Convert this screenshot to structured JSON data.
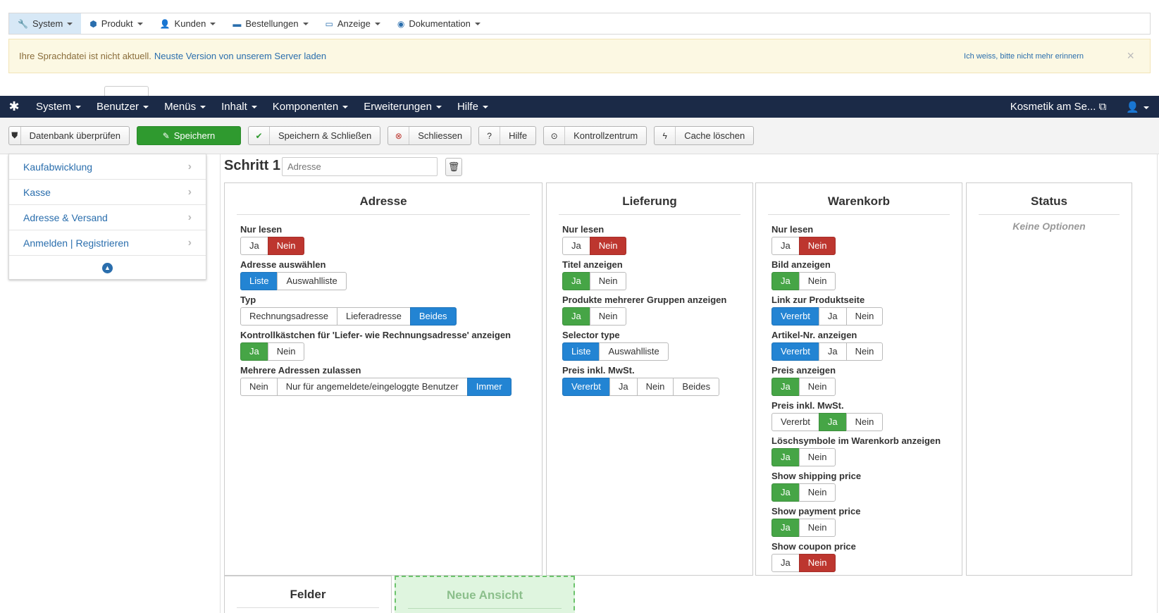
{
  "shop_menu": [
    {
      "label": "System",
      "icon": "wrench-icon",
      "glyph": "🔧"
    },
    {
      "label": "Produkt",
      "icon": "cubes-icon",
      "glyph": "⬢"
    },
    {
      "label": "Kunden",
      "icon": "user-icon",
      "glyph": "👤"
    },
    {
      "label": "Bestellungen",
      "icon": "credit-card-icon",
      "glyph": "▬"
    },
    {
      "label": "Anzeige",
      "icon": "monitor-icon",
      "glyph": "▭"
    },
    {
      "label": "Dokumentation",
      "icon": "life-ring-icon",
      "glyph": "◉"
    }
  ],
  "alert": {
    "text": "Ihre Sprachdatei ist nicht aktuell.",
    "link": "Neuste Version von unserem Server laden",
    "remind": "Ich weiss, bitte nicht mehr erinnern",
    "close": "×"
  },
  "admin_menu": [
    "System",
    "Benutzer",
    "Menüs",
    "Inhalt",
    "Komponenten",
    "Erweiterungen",
    "Hilfe"
  ],
  "admin_right": {
    "site": "Kosmetik am Se...",
    "external_glyph": "⧉",
    "user_glyph": "👤"
  },
  "toolbar": {
    "check_db": "Datenbank überprüfen",
    "save": "Speichern",
    "save_close": "Speichern & Schließen",
    "close": "Schliessen",
    "help": "Hilfe",
    "control": "Kontrollzentrum",
    "cache": "Cache löschen"
  },
  "sidebar": {
    "items": [
      "Kaufabwicklung",
      "Kasse",
      "Adresse & Versand",
      "Anmelden | Registrieren"
    ]
  },
  "step": {
    "title": "Schritt 1",
    "placeholder": "Adresse"
  },
  "panels": {
    "adresse": {
      "title": "Adresse",
      "fields": [
        {
          "label": "Nur lesen",
          "options": [
            "Ja",
            "Nein"
          ],
          "active": 1,
          "color": "red"
        },
        {
          "label": "Adresse auswählen",
          "options": [
            "Liste",
            "Auswahlliste"
          ],
          "active": 0,
          "color": "blue"
        },
        {
          "label": "Typ",
          "options": [
            "Rechnungsadresse",
            "Lieferadresse",
            "Beides"
          ],
          "active": 2,
          "color": "blue"
        },
        {
          "label": "Kontrollkästchen für 'Liefer- wie Rechnungsadresse' anzeigen",
          "options": [
            "Ja",
            "Nein"
          ],
          "active": 0,
          "color": "green"
        },
        {
          "label": "Mehrere Adressen zulassen",
          "options": [
            "Nein",
            "Nur für angemeldete/eingeloggte Benutzer",
            "Immer"
          ],
          "active": 2,
          "color": "blue"
        }
      ]
    },
    "lieferung": {
      "title": "Lieferung",
      "fields": [
        {
          "label": "Nur lesen",
          "options": [
            "Ja",
            "Nein"
          ],
          "active": 1,
          "color": "red"
        },
        {
          "label": "Titel anzeigen",
          "options": [
            "Ja",
            "Nein"
          ],
          "active": 0,
          "color": "green"
        },
        {
          "label": "Produkte mehrerer Gruppen anzeigen",
          "options": [
            "Ja",
            "Nein"
          ],
          "active": 0,
          "color": "green"
        },
        {
          "label": "Selector type",
          "options": [
            "Liste",
            "Auswahlliste"
          ],
          "active": 0,
          "color": "blue"
        },
        {
          "label": "Preis inkl. MwSt.",
          "options": [
            "Vererbt",
            "Ja",
            "Nein",
            "Beides"
          ],
          "active": 0,
          "color": "blue"
        }
      ]
    },
    "warenkorb": {
      "title": "Warenkorb",
      "fields": [
        {
          "label": "Nur lesen",
          "options": [
            "Ja",
            "Nein"
          ],
          "active": 1,
          "color": "red"
        },
        {
          "label": "Bild anzeigen",
          "options": [
            "Ja",
            "Nein"
          ],
          "active": 0,
          "color": "green"
        },
        {
          "label": "Link zur Produktseite",
          "options": [
            "Vererbt",
            "Ja",
            "Nein"
          ],
          "active": 0,
          "color": "blue"
        },
        {
          "label": "Artikel-Nr. anzeigen",
          "options": [
            "Vererbt",
            "Ja",
            "Nein"
          ],
          "active": 0,
          "color": "blue"
        },
        {
          "label": "Preis anzeigen",
          "options": [
            "Ja",
            "Nein"
          ],
          "active": 0,
          "color": "green"
        },
        {
          "label": "Preis inkl. MwSt.",
          "options": [
            "Vererbt",
            "Ja",
            "Nein"
          ],
          "active": 1,
          "color": "green"
        },
        {
          "label": "Löschsymbole im Warenkorb anzeigen",
          "options": [
            "Ja",
            "Nein"
          ],
          "active": 0,
          "color": "green"
        },
        {
          "label": "Show shipping price",
          "options": [
            "Ja",
            "Nein"
          ],
          "active": 0,
          "color": "green"
        },
        {
          "label": "Show payment price",
          "options": [
            "Ja",
            "Nein"
          ],
          "active": 0,
          "color": "green"
        },
        {
          "label": "Show coupon price",
          "options": [
            "Ja",
            "Nein"
          ],
          "active": 1,
          "color": "red"
        }
      ]
    },
    "status": {
      "title": "Status",
      "empty": "Keine Optionen"
    },
    "felder": {
      "title": "Felder"
    },
    "neue_ansicht": {
      "title": "Neue Ansicht"
    }
  }
}
